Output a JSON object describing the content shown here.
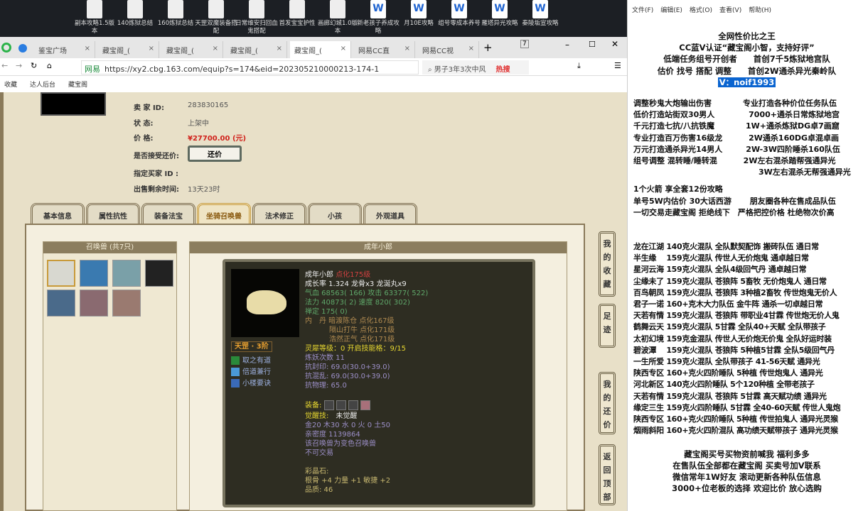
{
  "desktop": {
    "icons": [
      {
        "label": "副本攻略1.5版本",
        "type": "txt"
      },
      {
        "label": "140炼狱总结",
        "type": "txt"
      },
      {
        "label": "160炼狱总结",
        "type": "txt"
      },
      {
        "label": "天罡双魔装备搭配",
        "type": "txt"
      },
      {
        "label": "日常维安扫回血鬼搭配",
        "type": "txt"
      },
      {
        "label": "首发宝宝护性",
        "type": "txt"
      },
      {
        "label": "画廊幻城1.0版本",
        "type": "txt"
      },
      {
        "label": "新老孩子养成攻略",
        "type": "word"
      },
      {
        "label": "月10E攻略",
        "type": "word"
      },
      {
        "label": "组号零成本养号",
        "type": "word"
      },
      {
        "label": "雁塔异光攻略",
        "type": "word"
      },
      {
        "label": "秦陵垢宣攻略",
        "type": "word"
      }
    ]
  },
  "browser": {
    "tabs": [
      {
        "label": "鉴宝广场"
      },
      {
        "label": "藏宝阁_("
      },
      {
        "label": "藏宝阁_("
      },
      {
        "label": "藏宝阁_("
      },
      {
        "label": "藏宝阁_(",
        "active": true
      },
      {
        "label": "网易CC直"
      },
      {
        "label": "网易CC视"
      }
    ],
    "window_badge": "7",
    "url": "https://xy2.cbg.163.com/equip?s=174&eid=202305210000213-174-1",
    "site_label": "网易",
    "search_value": "男子3年3次中风",
    "hot_label": "热搜",
    "bookmarks": [
      "收藏",
      "达人后台",
      "藏宝阁"
    ]
  },
  "listing": {
    "seller_id_label": "卖 家 ID:",
    "seller_id": "283830165",
    "status_label": "状 态:",
    "status": "上架中",
    "price_label": "价 格:",
    "price": "¥27700.00 (元)",
    "bargain_label": "是否接受还价:",
    "bargain_button": "还价",
    "buyer_label": "指定买家 ID :",
    "remaining_label": "出售剩余时间:",
    "remaining": "13天23时"
  },
  "tabs": [
    {
      "label": "基本信息"
    },
    {
      "label": "属性抗性"
    },
    {
      "label": "装备法宝"
    },
    {
      "label": "坐骑召唤兽",
      "active": true
    },
    {
      "label": "法术修正"
    },
    {
      "label": "小孩"
    },
    {
      "label": "外观道具"
    }
  ],
  "summons": {
    "header": "召唤兽 (共7只)",
    "count": 7
  },
  "detail": {
    "header": "成年小郎",
    "name": "成年小郎",
    "name_tag": "点化175级",
    "growth": "成长率 1.324 龙骨x3 龙涎丸x9",
    "hp": "气血 68563( 166) 攻击 63377( 522)",
    "mp": "法力 40873( 2) 速度 820( 302)",
    "calm": "禅定 175( 0)",
    "dan1": "内　丹 暗渡陈仓 点化167级",
    "dan2": "隔山打牛 点化171级",
    "dan3": "浩然正气 点化171级",
    "rank": "天罡 · 3阶",
    "skills": [
      "取之有道",
      "倍道兼行",
      "小楼要诀"
    ],
    "spirit": "灵犀等级：0 开启技能格：9/15",
    "refine": "炼妖次数 11",
    "res1": "抗封印: 69.0(30.0+39.0)",
    "res2": "抗混乱: 69.0(30.0+39.0)",
    "res3": "抗物理: 65.0",
    "equip_label": "装备:",
    "awaken_label": "觉醒技:",
    "awaken_value": "未觉醒",
    "elements": "金20 木30 水 0 火 0 土50",
    "intimacy": "亲密度 1139864",
    "note1": "该召唤兽为变色召唤兽",
    "note2": "不可交易",
    "crystal_label": "彩晶石:",
    "crystal": "根骨 +4 力量 +1 敏捷 +2",
    "quality": "品质: 46"
  },
  "side_buttons": [
    "我的收藏",
    "足迹",
    "我的还价",
    "返回顶部"
  ],
  "notepad": {
    "menu": [
      "文件(F)",
      "编辑(E)",
      "格式(O)",
      "查看(V)",
      "帮助(H)"
    ],
    "header_lines": [
      "全网性价比之王",
      "CC蓝V认证“藏宝阁小智，支持好评”",
      "低端任务组号开创者　　首创7千5炼狱地宫队",
      "估价 找号 搭配 调整　　首创2W通杀异光秦岭队"
    ],
    "contact": "V：noif1993",
    "block1": [
      "调整秒鬼大炮输出伤害　　　　专业打造各种价位任务队伍",
      "低价打造站街双30男人　　　　 7000+通杀日常炼狱地宫",
      "千元打造七抗/八抗铁魔　　　　1W+通杀炼狱DG卓7画窟",
      "专业打造百万伤害16级龙　　　 2W通杀160DG卓混卓画",
      "万元打造通杀异光14男人　　　2W-3W四阶睡杀160队伍",
      "组号调整 混转睡/睡转混　　　 2W左右混杀踏帮强通异光",
      "　　　　　　　　　　　　　　　　3W左右混杀无帮强通异光"
    ],
    "block2": [
      "1个火箭 享全套12份攻略",
      "单号5W内估价 30大话西游　　 朋友圈各种在售成品队伍",
      "一切交易走藏宝阁 拒绝线下　严格把控价格 杜绝物次价高"
    ],
    "teams": [
      "龙在江湖 140克火混队 全队默契配饰 搬砖队伍 通日常",
      "半生缘　 159克火混队 传世人无价炮鬼 通卓越日常",
      "星河云海 159克火混队 全队4级回气丹 通卓越日常",
      "尘缘未了 159克火混队 苍狼阵 5畜牧 无价炮鬼人 通日常",
      "百鸟朝凤 159克火混队 苍狼阵 3种植2畜牧 传世炮鬼无价人",
      "君子一诺 160+克木大力队伍 金牛阵 通杀一切卓越日常",
      "天若有情 159克火混队 苍狼阵 带职业4甘霖 传世炮无价人鬼",
      "鹤舞云天 159克火混队 5甘霖 全队40+天赋 全队带孩子",
      "太初幻境 159克金混队 传世人无价炮无价鬼 全队好运时装",
      "碧波潭　 159克火混队 苍狼阵 5种植5甘霖 全队5级回气丹",
      "一生所爱 159克火混队 全队带孩子 41-56天赋 通异光",
      "陕西专区 160+克火四阶睡队 5种植 传世炮鬼人 通异光",
      "河北新区 140克火四阶睡队 5个120种植 全带老孩子",
      "天若有情 159克火混队 苍狼阵 5甘霖 高天赋功绩 通异光",
      "缘定三生 159克火四阶睡队 5甘霖 全40-60天赋 传世人鬼炮",
      "陕西专区 160+克火四阶睡队 5种植 传世拍鬼人 通异光灵猴",
      "烟雨斜阳 160+克火四阶混队 高功绩天赋带孩子 通异光灵猴"
    ],
    "footer": [
      "藏宝阁买号买物资前喊我 福利多多",
      "在售队伍全部都在藏宝阁 买卖号加V联系",
      "微信常年1W好友 滚动更新各种队伍信息",
      "3000+位老板的选择 欢迎比价 放心选购"
    ]
  },
  "colors": {
    "price": "#d0201a",
    "card_bg": "#2e2d22",
    "green_stat": "#5fa86a",
    "gold": "#e8d830",
    "purple": "#9c8fc8",
    "page_bg": "#e8e0c8"
  }
}
